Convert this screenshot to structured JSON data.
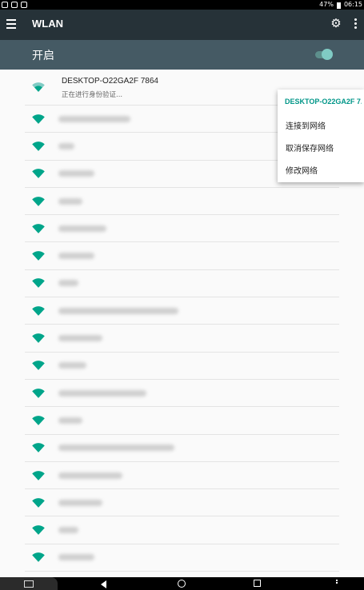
{
  "status_bar": {
    "battery": "47%",
    "time": "06:15"
  },
  "toolbar": {
    "title": "WLAN",
    "menu_icon": "hamburger-menu-icon",
    "settings_icon": "gear-icon",
    "overflow_icon": "more-vert-icon"
  },
  "wifi_master": {
    "label": "开启",
    "enabled": true,
    "accent": "#80cbc4"
  },
  "networks": {
    "connecting": {
      "ssid": "DESKTOP-O22GA2F 7864",
      "status": "正在进行身份验证..."
    },
    "other_count": 17
  },
  "context_menu": {
    "title": "DESKTOP-O22GA2F 7...",
    "items": [
      "连接到网络",
      "取消保存网络",
      "修改网络"
    ]
  },
  "nav_bar": {
    "back_icon": "back-icon",
    "home_icon": "home-icon",
    "recents_icon": "recents-icon"
  },
  "colors": {
    "toolbar": "#263238",
    "switchbar": "#455a64",
    "wifi_icon": "#00a58a",
    "accent_text": "#009688"
  }
}
